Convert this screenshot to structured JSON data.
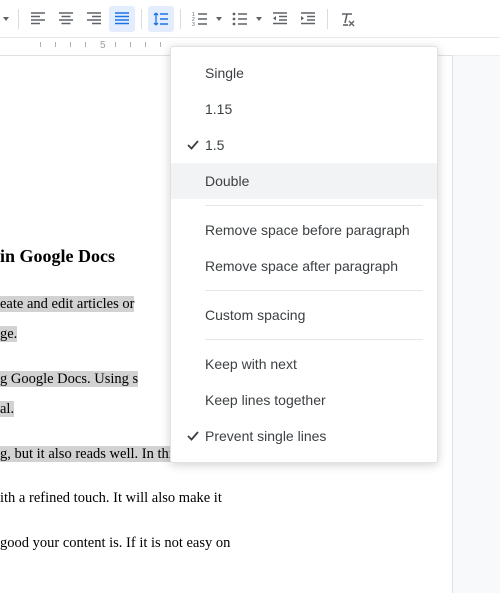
{
  "ruler": {
    "label": "5"
  },
  "toolbar": {
    "align_left": "Align left",
    "align_center": "Align center",
    "align_right": "Align right",
    "align_justify": "Justify",
    "line_spacing": "Line & paragraph spacing",
    "numbered_list": "Numbered list",
    "bulleted_list": "Bulleted list",
    "decrease_indent": "Decrease indent",
    "increase_indent": "Increase indent",
    "clear_formatting": "Clear formatting"
  },
  "menu": {
    "items": [
      {
        "label": "Single",
        "checked": false
      },
      {
        "label": "1.15",
        "checked": false
      },
      {
        "label": "1.5",
        "checked": true
      },
      {
        "label": "Double",
        "checked": false,
        "hover": true
      }
    ],
    "paragraph": [
      {
        "label": "Remove space before paragraph"
      },
      {
        "label": "Remove space after paragraph"
      }
    ],
    "custom": {
      "label": "Custom spacing"
    },
    "keep": [
      {
        "label": "Keep with next",
        "checked": false
      },
      {
        "label": "Keep lines together",
        "checked": false
      },
      {
        "label": "Prevent single lines",
        "checked": true
      }
    ]
  },
  "doc": {
    "heading": "in Google Docs",
    "p1a": "eate and edit articles or",
    "p1b": "ge.",
    "p2a": "g Google Docs.  Using s",
    "p2b": "al.",
    "p3": "g, but it also reads well. In this article,",
    "p4": "ith a refined touch. It will also make it",
    "p5": "good your content is. If it is not easy on"
  }
}
